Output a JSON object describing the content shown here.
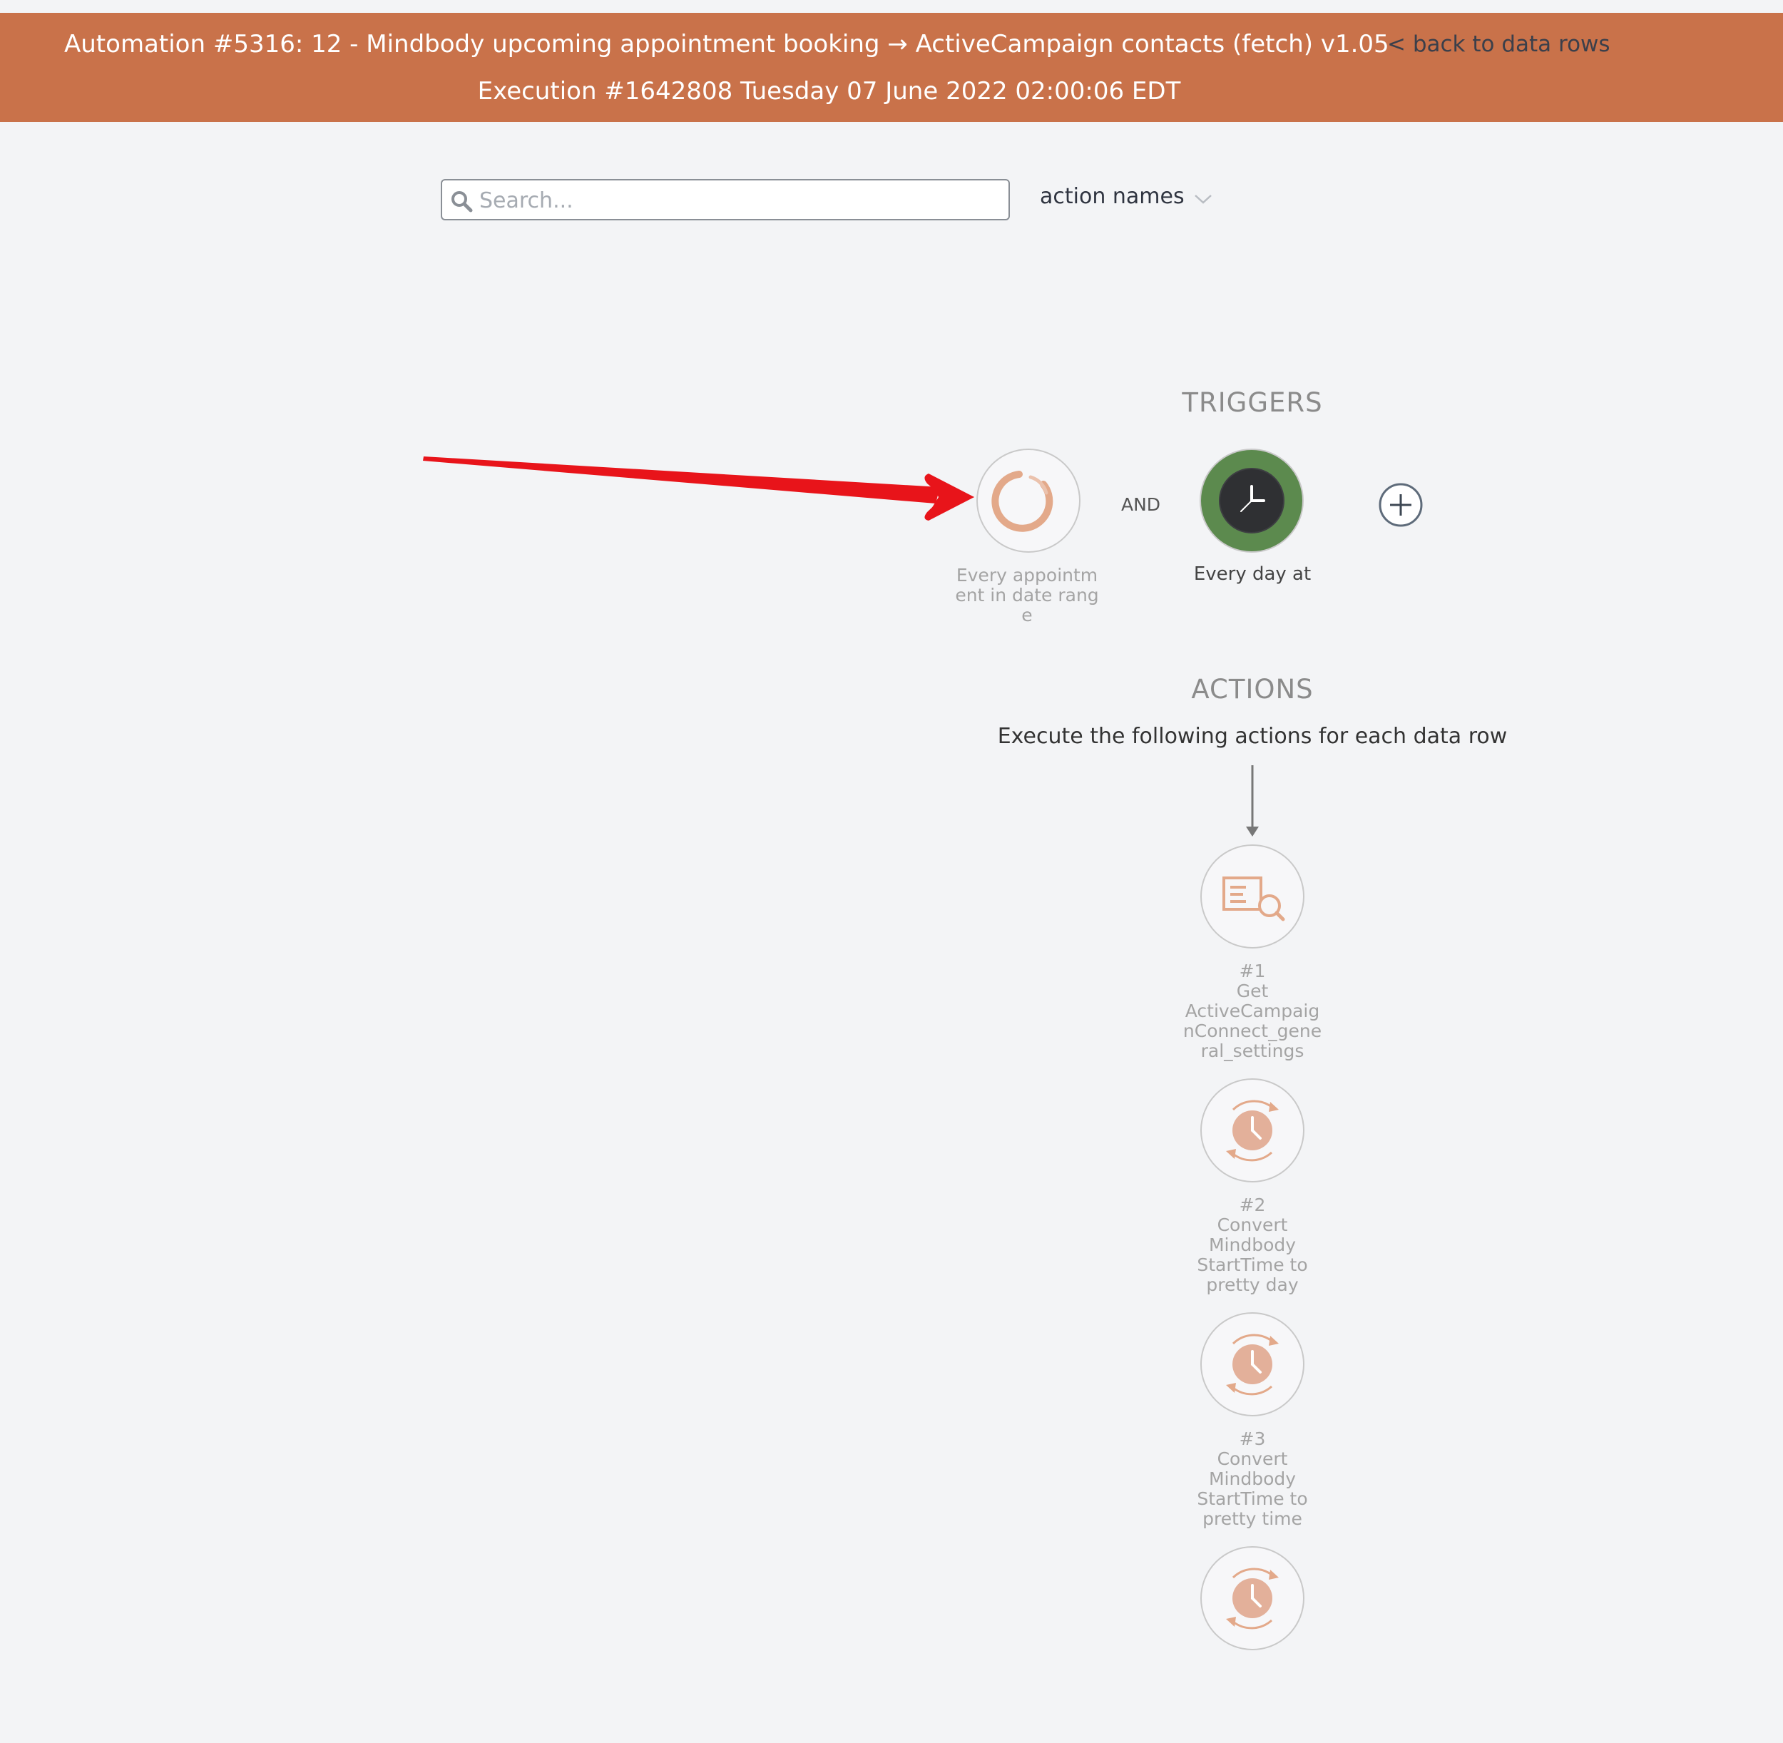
{
  "header": {
    "title": "Automation #5316: 12 - Mindbody upcoming appointment booking → ActiveCampaign contacts (fetch) v1.05",
    "back_link": "< back to data rows",
    "execution": "Execution #1642808 Tuesday 07 June 2022 02:00:06 EDT"
  },
  "search": {
    "placeholder": "Search...",
    "value": ""
  },
  "view_dropdown": {
    "selected": "action names"
  },
  "triggers": {
    "title": "TRIGGERS",
    "connector": "AND",
    "items": [
      {
        "label": "Every appointment in date range",
        "icon": "mindbody-ring-icon"
      },
      {
        "label": "Every day at",
        "icon": "clock-icon"
      }
    ]
  },
  "actions": {
    "title": "ACTIONS",
    "description": "Execute the following actions for each data row",
    "items": [
      {
        "label": "#1\nGet\nActiveCampaig\nnConnect_gene\nral_settings",
        "icon": "document-search-icon"
      },
      {
        "label": "#2\nConvert\nMindbody\nStartTime to\npretty day",
        "icon": "time-convert-icon"
      },
      {
        "label": "#3\nConvert\nMindbody\nStartTime to\npretty time",
        "icon": "time-convert-icon"
      },
      {
        "label": "",
        "icon": "time-convert-icon"
      }
    ]
  },
  "colors": {
    "header_bg": "#c9724a",
    "accent": "#e3a98a",
    "clock_bg": "#5c8a4e",
    "annotation_arrow": "#e8141a"
  }
}
